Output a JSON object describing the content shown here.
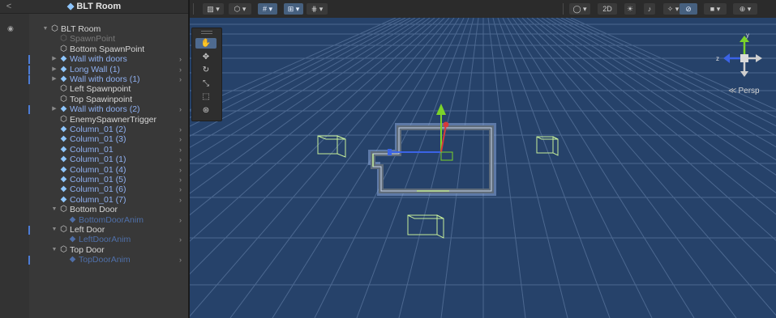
{
  "hierarchy": {
    "title": "BLT Room",
    "back_glyph": "<",
    "eye_glyph": "◉",
    "items": [
      {
        "label": "BLT Room",
        "indent": 0,
        "icon": "object",
        "color": "white",
        "expand": "open",
        "mark": false,
        "chev": false
      },
      {
        "label": "SpawnPoint",
        "indent": 1,
        "icon": "object",
        "color": "gray",
        "expand": "none",
        "mark": false,
        "chev": false
      },
      {
        "label": "Bottom SpawnPoint",
        "indent": 1,
        "icon": "object",
        "color": "white",
        "expand": "none",
        "mark": false,
        "chev": false
      },
      {
        "label": "Wall with doors",
        "indent": 1,
        "icon": "prefab",
        "color": "blue",
        "expand": "closed",
        "mark": true,
        "chev": true
      },
      {
        "label": "Long Wall (1)",
        "indent": 1,
        "icon": "prefab",
        "color": "blue",
        "expand": "closed",
        "mark": true,
        "chev": true
      },
      {
        "label": "Wall with doors (1)",
        "indent": 1,
        "icon": "prefab",
        "color": "blue",
        "expand": "closed",
        "mark": true,
        "chev": true
      },
      {
        "label": "Left Spawnpoint",
        "indent": 1,
        "icon": "object",
        "color": "white",
        "expand": "none",
        "mark": false,
        "chev": false
      },
      {
        "label": "Top Spawinpoint",
        "indent": 1,
        "icon": "object",
        "color": "white",
        "expand": "none",
        "mark": false,
        "chev": false
      },
      {
        "label": "Wall with doors (2)",
        "indent": 1,
        "icon": "prefab",
        "color": "blue",
        "expand": "closed",
        "mark": true,
        "chev": true
      },
      {
        "label": "EnemySpawnerTrigger",
        "indent": 1,
        "icon": "object",
        "color": "white",
        "expand": "none",
        "mark": false,
        "chev": false
      },
      {
        "label": "Column_01 (2)",
        "indent": 1,
        "icon": "prefab",
        "color": "blue",
        "expand": "none",
        "mark": false,
        "chev": true
      },
      {
        "label": "Column_01 (3)",
        "indent": 1,
        "icon": "prefab",
        "color": "blue",
        "expand": "none",
        "mark": false,
        "chev": true
      },
      {
        "label": "Column_01",
        "indent": 1,
        "icon": "prefab",
        "color": "blue",
        "expand": "none",
        "mark": false,
        "chev": true
      },
      {
        "label": "Column_01 (1)",
        "indent": 1,
        "icon": "prefab",
        "color": "blue",
        "expand": "none",
        "mark": false,
        "chev": true
      },
      {
        "label": "Column_01 (4)",
        "indent": 1,
        "icon": "prefab",
        "color": "blue",
        "expand": "none",
        "mark": false,
        "chev": true
      },
      {
        "label": "Column_01 (5)",
        "indent": 1,
        "icon": "prefab",
        "color": "blue",
        "expand": "none",
        "mark": false,
        "chev": true
      },
      {
        "label": "Column_01 (6)",
        "indent": 1,
        "icon": "prefab",
        "color": "blue",
        "expand": "none",
        "mark": false,
        "chev": true
      },
      {
        "label": "Column_01 (7)",
        "indent": 1,
        "icon": "prefab",
        "color": "blue",
        "expand": "none",
        "mark": false,
        "chev": true
      },
      {
        "label": "Bottom Door",
        "indent": 1,
        "icon": "object",
        "color": "white",
        "expand": "open",
        "mark": false,
        "chev": false
      },
      {
        "label": "BottomDoorAnim",
        "indent": 2,
        "icon": "prefab-dim",
        "color": "faded",
        "expand": "none",
        "mark": false,
        "chev": true
      },
      {
        "label": "Left Door",
        "indent": 1,
        "icon": "object",
        "color": "white",
        "expand": "open",
        "mark": true,
        "chev": false
      },
      {
        "label": "LeftDoorAnim",
        "indent": 2,
        "icon": "prefab-dim",
        "color": "faded",
        "expand": "none",
        "mark": false,
        "chev": true
      },
      {
        "label": "Top Door",
        "indent": 1,
        "icon": "object",
        "color": "white",
        "expand": "open",
        "mark": false,
        "chev": false
      },
      {
        "label": "TopDoorAnim",
        "indent": 2,
        "icon": "prefab-dim",
        "color": "faded",
        "expand": "none",
        "mark": true,
        "chev": true
      }
    ]
  },
  "scene_toolbar": {
    "left": [
      {
        "name": "draw-mode-dropdown",
        "glyph": "▨ ▾"
      },
      {
        "name": "render-mode-dropdown",
        "glyph": "⬡ ▾"
      },
      {
        "name": "grid-toggle",
        "glyph": "# ▾"
      },
      {
        "name": "snap-toggle",
        "glyph": "⊞ ▾"
      },
      {
        "name": "increment-snap",
        "glyph": "⋕ ▾"
      }
    ],
    "right": [
      {
        "name": "shading-dropdown",
        "glyph": "◯ ▾"
      },
      {
        "name": "2d-toggle",
        "glyph": "2D"
      },
      {
        "name": "lighting-toggle",
        "glyph": "☀"
      },
      {
        "name": "audio-toggle",
        "glyph": "♪"
      },
      {
        "name": "effects-dropdown",
        "glyph": "✧ ▾"
      },
      {
        "name": "hidden-objects-toggle",
        "glyph": "⊘"
      },
      {
        "name": "camera-dropdown",
        "glyph": "■ ▾"
      },
      {
        "name": "gizmos-dropdown",
        "glyph": "⊕ ▾"
      }
    ]
  },
  "tools": [
    {
      "name": "hand-tool",
      "glyph": "✋"
    },
    {
      "name": "move-tool",
      "glyph": "✥"
    },
    {
      "name": "rotate-tool",
      "glyph": "↻"
    },
    {
      "name": "scale-tool",
      "glyph": "⤡"
    },
    {
      "name": "rect-tool",
      "glyph": "⬚"
    },
    {
      "name": "transform-tool",
      "glyph": "⊛"
    }
  ],
  "gizmo": {
    "y_label": "y",
    "z_label": "z"
  },
  "view_label": "Persp",
  "colors": {
    "scene_bg": "#26426a",
    "grid_line": "#4c6890",
    "selection_outline": "#8aa8d8",
    "wireframe": "#c7ef9a",
    "axis_x": "#3b63e6",
    "axis_y": "#7bd32a",
    "axis_z": "#d53b3b"
  }
}
